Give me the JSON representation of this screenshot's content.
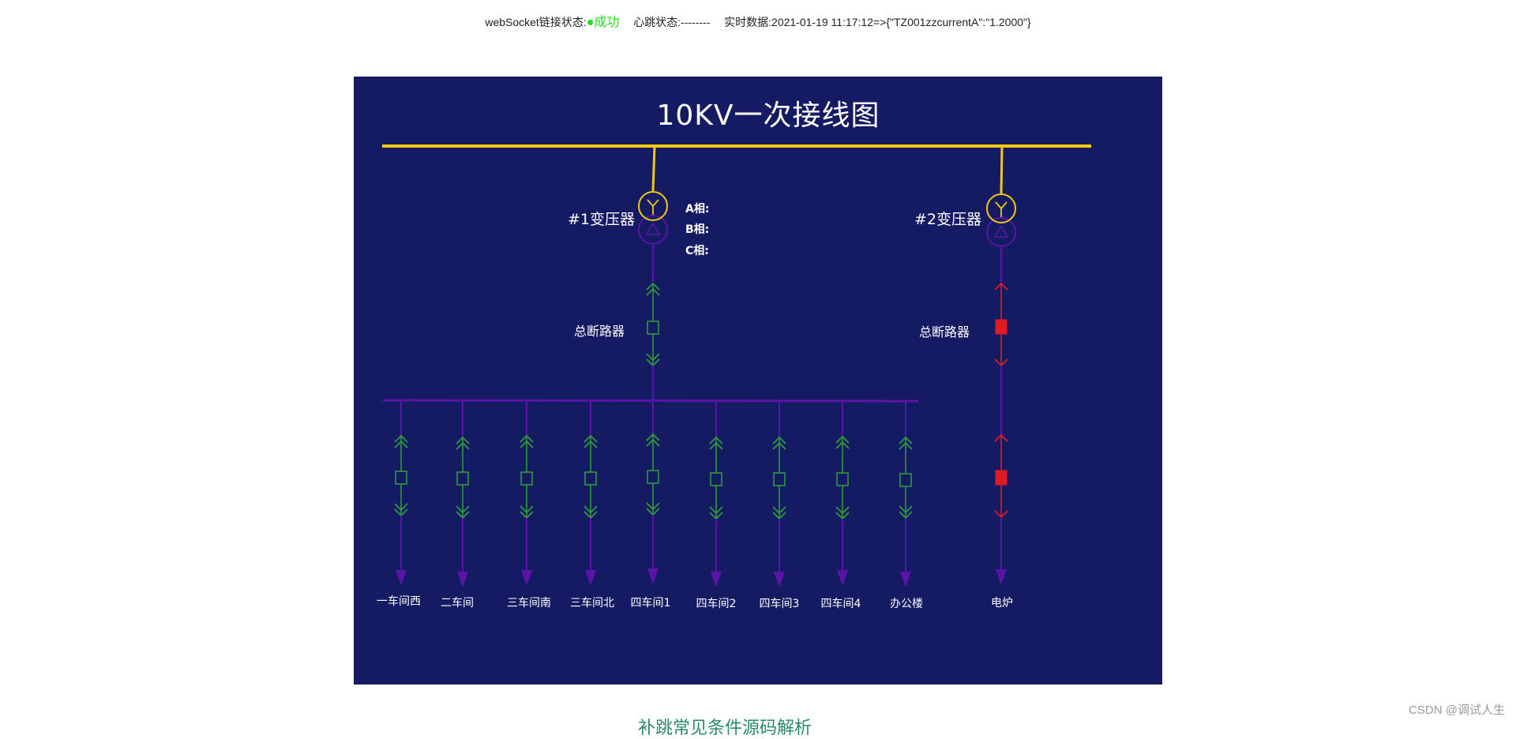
{
  "status": {
    "ws_label": "webSocket链接状态:",
    "ws_value": "●成功",
    "heartbeat": "心跳状态:--------",
    "realtime_label": "实时数据:",
    "realtime_value": "2021-01-19 11:17:12=>{\"TZ001zzcurrentA\":\"1.2000\"}"
  },
  "diagram": {
    "title": "10KV一次接线图",
    "transformer1": {
      "label": "#1变压器",
      "breaker_label": "总断路器",
      "phases": [
        "A相:",
        "B相:",
        "C相:"
      ]
    },
    "transformer2": {
      "label": "#2变压器",
      "breaker_label": "总断路器"
    },
    "feeders": [
      "一车间西",
      "二车间",
      "三车间南",
      "三车间北",
      "四车间1",
      "四车间2",
      "四车间3",
      "四车间4",
      "办公楼",
      "电炉"
    ],
    "colors": {
      "background": "#151b63",
      "main_bus": "#f2c811",
      "feeder_line": "#5a14a8",
      "switch_closed": "#2e9b3b",
      "switch_open": "#e01b24"
    }
  },
  "watermark": "CSDN @调试人生",
  "bottom_teaser": "补跳常见条件源码解析"
}
